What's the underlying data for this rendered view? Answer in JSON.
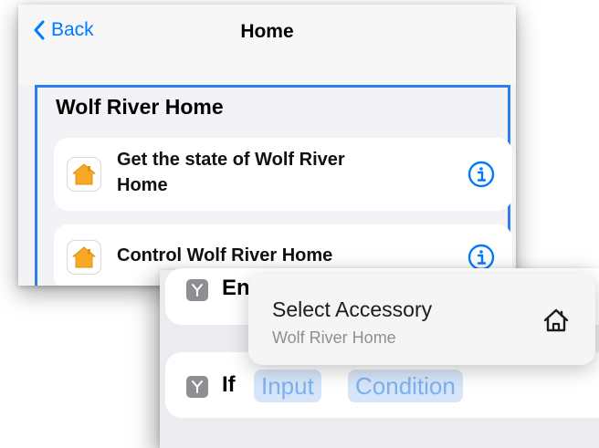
{
  "home_sheet": {
    "nav": {
      "back_label": "Back",
      "title": "Home"
    },
    "section_title": "Wolf River Home",
    "actions": [
      {
        "label": "Get the state of Wolf River Home",
        "icon": "home-app-icon",
        "info_icon": "info-icon"
      },
      {
        "label": "Control Wolf River Home",
        "icon": "home-app-icon",
        "info_icon": "info-icon"
      }
    ]
  },
  "editor": {
    "rows": [
      {
        "icon": "branch-icon",
        "text": "En"
      },
      {
        "icon": "branch-icon",
        "text": "If",
        "tokens": [
          "Input",
          "Condition"
        ]
      }
    ]
  },
  "popover": {
    "title": "Select Accessory",
    "subtitle": "Wolf River Home",
    "icon": "house-icon"
  },
  "colors": {
    "accent": "#007aff",
    "selection_border": "#2f7ff0",
    "token_background": "#d6e5f9",
    "token_text": "#7cb1ee",
    "home_icon_orange": "#f7a825"
  }
}
